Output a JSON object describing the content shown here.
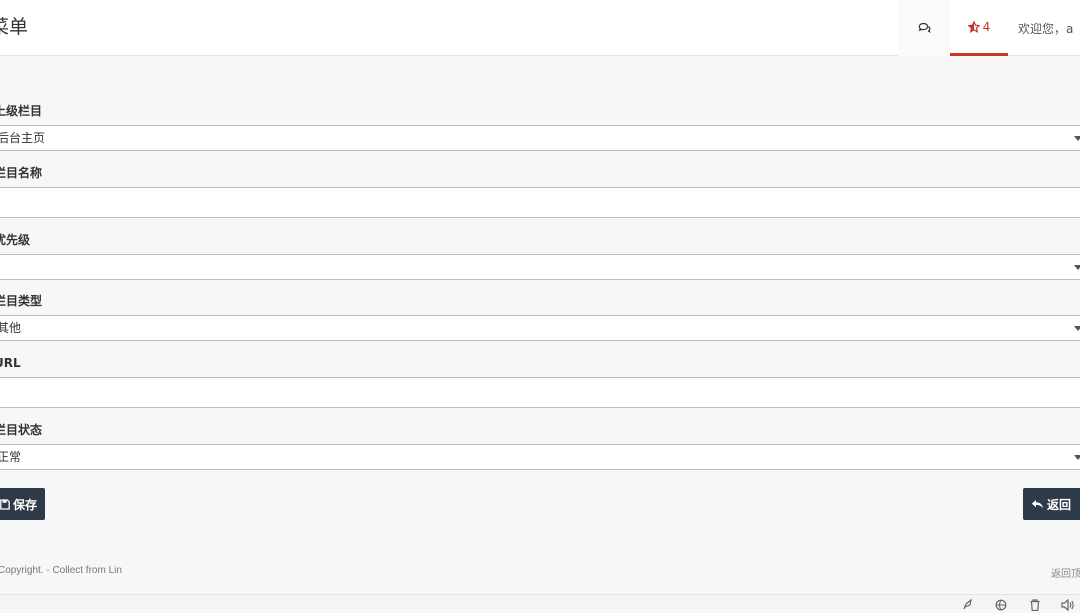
{
  "header": {
    "title": "菜单",
    "chat_icon": "comments-icon",
    "favorites_icon": "star-half-icon",
    "favorites_count": "4",
    "welcome_text": "欢迎您，a",
    "accent_color": "#c0392b"
  },
  "form": {
    "parent": {
      "label": "上级栏目",
      "value": "后台主页"
    },
    "name": {
      "label": "栏目名称",
      "value": "",
      "placeholder": ""
    },
    "priority": {
      "label": "优先级",
      "value": ""
    },
    "type": {
      "label": "栏目类型",
      "value": "其他"
    },
    "url": {
      "label": "URL",
      "value": "",
      "placeholder": ""
    },
    "status": {
      "label": "栏目状态",
      "value": "正常"
    }
  },
  "buttons": {
    "save_label": "保存",
    "save_icon": "save-icon",
    "back_label": "返回",
    "back_icon": "reply-icon",
    "button_color": "#2f3a48"
  },
  "footer": {
    "copyright": "Copyright. - Collect from Lin",
    "back_to_top": "返回顶部"
  },
  "bottom_bar_icons": [
    "rocket-icon",
    "globe-icon",
    "trash-icon",
    "volume-icon"
  ]
}
